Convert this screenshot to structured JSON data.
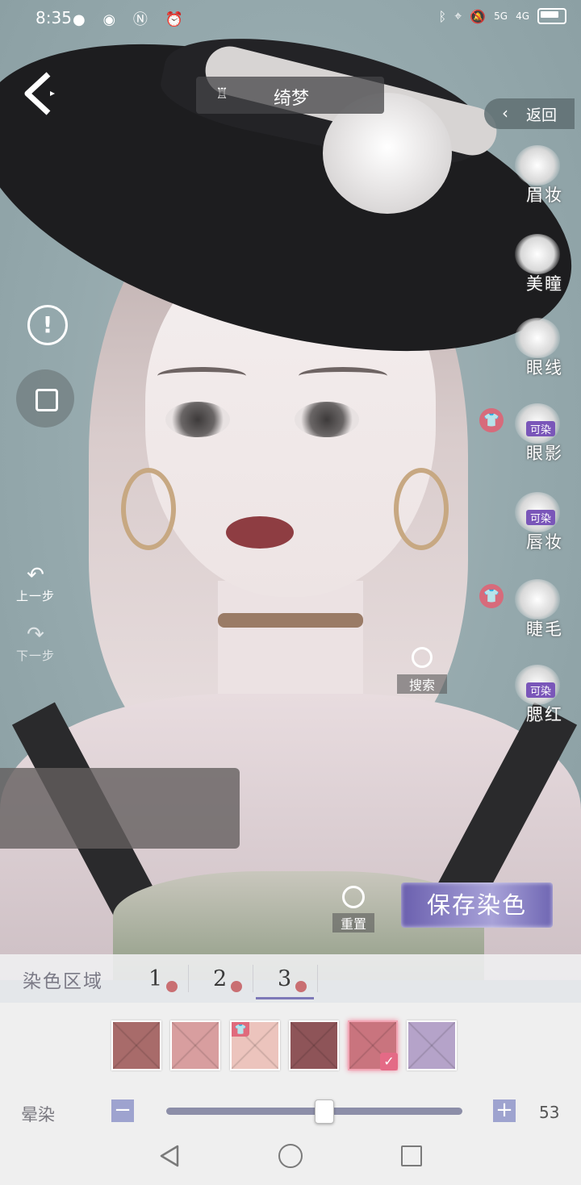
{
  "status_bar": {
    "time": "8:35",
    "left_icons": [
      "wechat-icon",
      "eye-icon",
      "nfc-icon",
      "alarm-icon"
    ],
    "right_icons": [
      "bluetooth-icon",
      "location-icon",
      "mute-icon"
    ],
    "signal_1": "5G",
    "signal_2": "4G"
  },
  "header": {
    "outfit_name": "绮梦",
    "return_label": "返回"
  },
  "makeup_menu": [
    {
      "label": "眉妆",
      "dyeable": false,
      "shirt_badge": false
    },
    {
      "label": "美瞳",
      "dyeable": false,
      "shirt_badge": false
    },
    {
      "label": "眼线",
      "dyeable": false,
      "shirt_badge": false
    },
    {
      "label": "眼影",
      "dyeable": true,
      "shirt_badge": true
    },
    {
      "label": "唇妆",
      "dyeable": true,
      "shirt_badge": false
    },
    {
      "label": "睫毛",
      "dyeable": false,
      "shirt_badge": true
    },
    {
      "label": "腮红",
      "dyeable": true,
      "shirt_badge": false
    }
  ],
  "dyeable_tag": "可染",
  "left_controls": {
    "undo_label": "上一步",
    "redo_label": "下一步"
  },
  "search_label": "搜索",
  "reset_label": "重置",
  "save_label": "保存染色",
  "dye_panel": {
    "title": "染色区域",
    "tabs": [
      "1",
      "2",
      "3"
    ],
    "active_tab": 3,
    "swatches": [
      {
        "color": "#a86b6a",
        "has_shirt": false,
        "selected": false
      },
      {
        "color": "#d89e9f",
        "has_shirt": false,
        "selected": false
      },
      {
        "color": "#ecc4bd",
        "has_shirt": true,
        "selected": false
      },
      {
        "color": "#8e5458",
        "has_shirt": false,
        "selected": false
      },
      {
        "color": "#c9747e",
        "has_shirt": false,
        "selected": true
      },
      {
        "color": "#b5a3c9",
        "has_shirt": false,
        "selected": false
      }
    ],
    "slider_label": "晕染",
    "slider_value": 53,
    "slider_fraction": 0.53
  }
}
